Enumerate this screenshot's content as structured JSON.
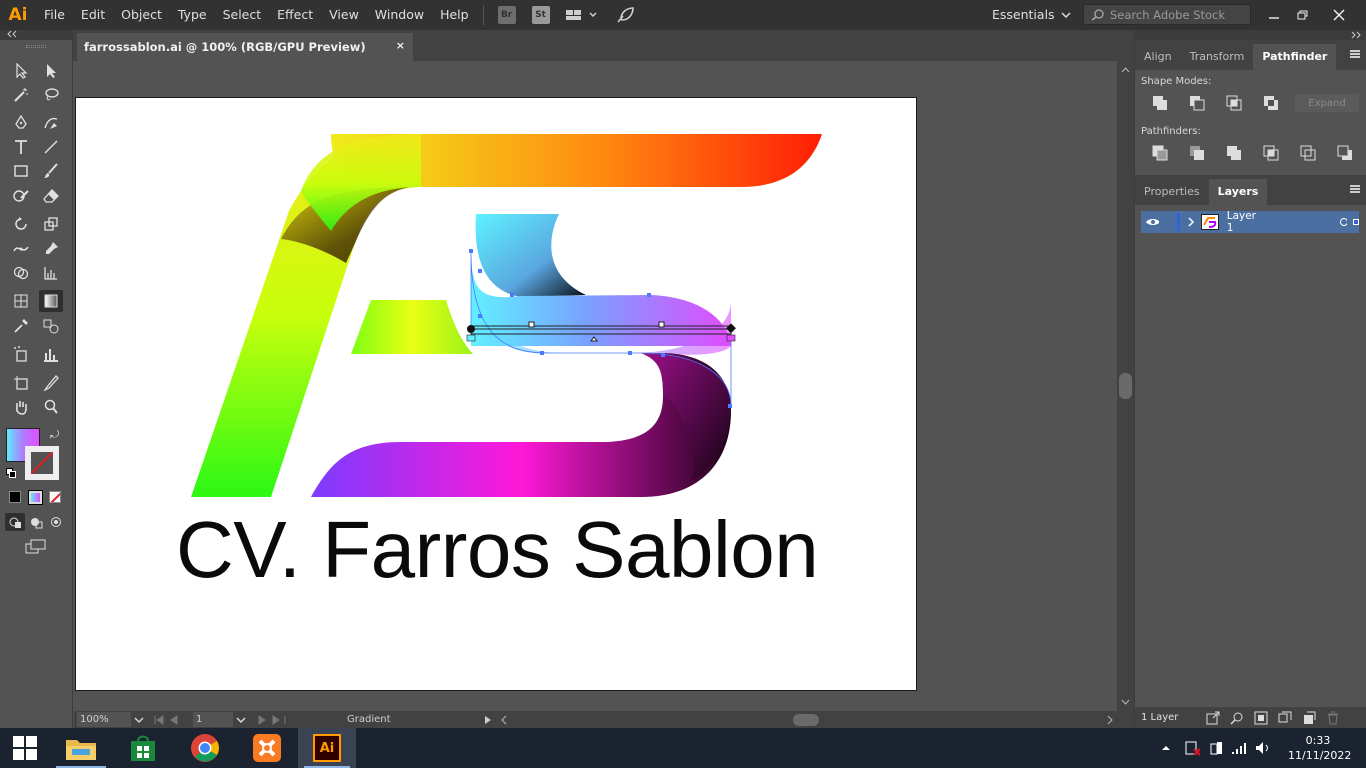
{
  "app": {
    "logo": "Ai",
    "brand_color": "#ff9a00"
  },
  "menu": [
    "File",
    "Edit",
    "Object",
    "Type",
    "Select",
    "Effect",
    "View",
    "Window",
    "Help"
  ],
  "bridge_badges": {
    "br": "Br",
    "st": "St"
  },
  "workspace": {
    "label": "Essentials"
  },
  "search": {
    "placeholder": "Search Adobe Stock"
  },
  "document_tab": {
    "title": "farrossablon.ai @ 100% (RGB/GPU Preview)",
    "close": "×"
  },
  "artwork": {
    "text": "CV. Farros Sablon"
  },
  "status_bar": {
    "zoom": "100%",
    "artboard": "1",
    "tool": "Gradient"
  },
  "right_panel": {
    "top_tabs": [
      "Align",
      "Transform",
      "Pathfinder"
    ],
    "active_top_tab": "Pathfinder",
    "shape_modes_label": "Shape Modes:",
    "expand_label": "Expand",
    "pathfinders_label": "Pathfinders:",
    "bottom_tabs": [
      "Properties",
      "Layers"
    ],
    "active_bottom_tab": "Layers",
    "layer_name": "Layer 1",
    "layer_count": "1 Layer",
    "layer_color": "#4a6fa0"
  },
  "taskbar": {
    "time": "0:33",
    "date": "11/11/2022",
    "active_app_label": "Ai"
  }
}
